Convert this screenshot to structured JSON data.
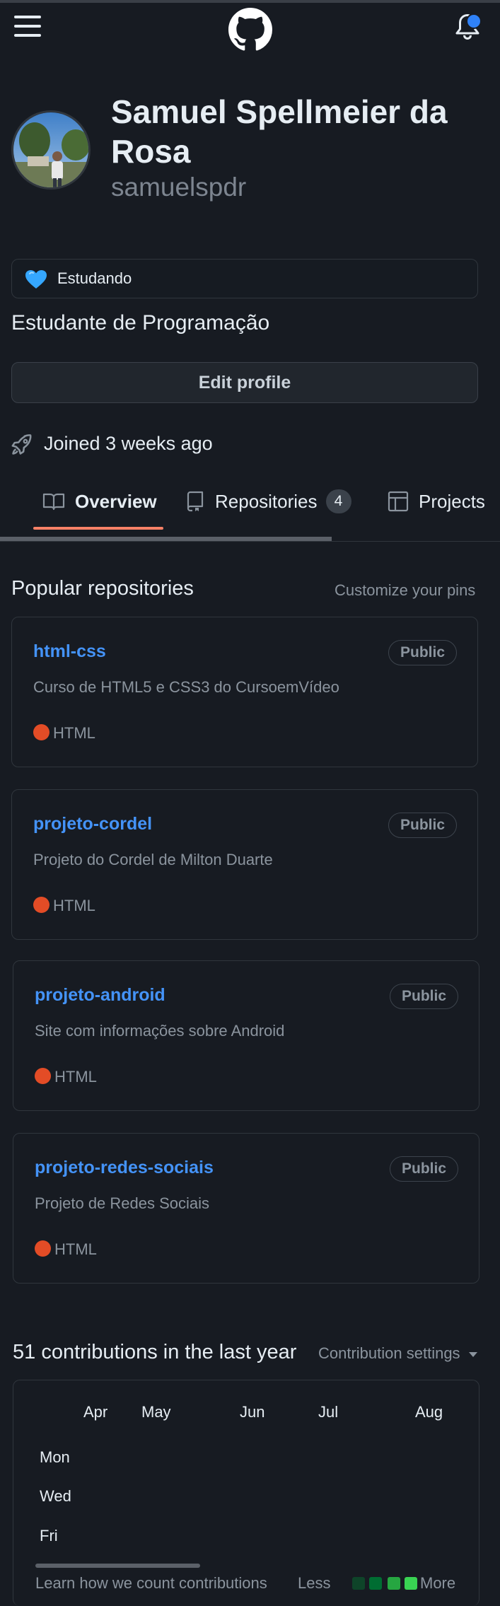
{
  "header": {
    "menu_icon": "hamburger-icon",
    "logo_icon": "github-mark-icon",
    "notification_icon": "bell-icon"
  },
  "profile": {
    "name": "Samuel Spellmeier da Rosa",
    "login": "samuelspdr",
    "status_emoji": "blue-heart-icon",
    "status_text": "Estudando",
    "bio": "Estudante de Programação",
    "edit_label": "Edit profile",
    "joined": "Joined 3 weeks ago"
  },
  "tabs": [
    {
      "label": "Overview",
      "icon": "book-icon",
      "selected": true
    },
    {
      "label": "Repositories",
      "icon": "repo-icon",
      "count": "4"
    },
    {
      "label": "Projects",
      "icon": "table-icon"
    }
  ],
  "popular": {
    "title": "Popular repositories",
    "customize": "Customize your pins",
    "repos": [
      {
        "name": "html-css",
        "visibility": "Public",
        "description": "Curso de HTML5 e CSS3 do CursoemVídeo",
        "language": "HTML"
      },
      {
        "name": "projeto-cordel",
        "visibility": "Public",
        "description": "Projeto do Cordel de Milton Duarte",
        "language": "HTML"
      },
      {
        "name": "projeto-android",
        "visibility": "Public",
        "description": "Site com informações sobre Android",
        "language": "HTML"
      },
      {
        "name": "projeto-redes-sociais",
        "visibility": "Public",
        "description": "Projeto de Redes Sociais",
        "language": "HTML"
      }
    ]
  },
  "contributions": {
    "title": "51 contributions in the last year",
    "settings": "Contribution settings",
    "months": [
      "Apr",
      "May",
      "Jun",
      "Jul",
      "Aug"
    ],
    "weekdays": [
      "Mon",
      "Wed",
      "Fri"
    ],
    "learn": "Learn how we count contributions",
    "less": "Less",
    "more": "More"
  },
  "colors": {
    "background": "#171b22",
    "link": "#4493f8",
    "html_language": "#e34c26",
    "tab_underline": "#f78166",
    "legend_levels": [
      "#0e4429",
      "#006d32",
      "#26a641",
      "#39d353"
    ]
  }
}
